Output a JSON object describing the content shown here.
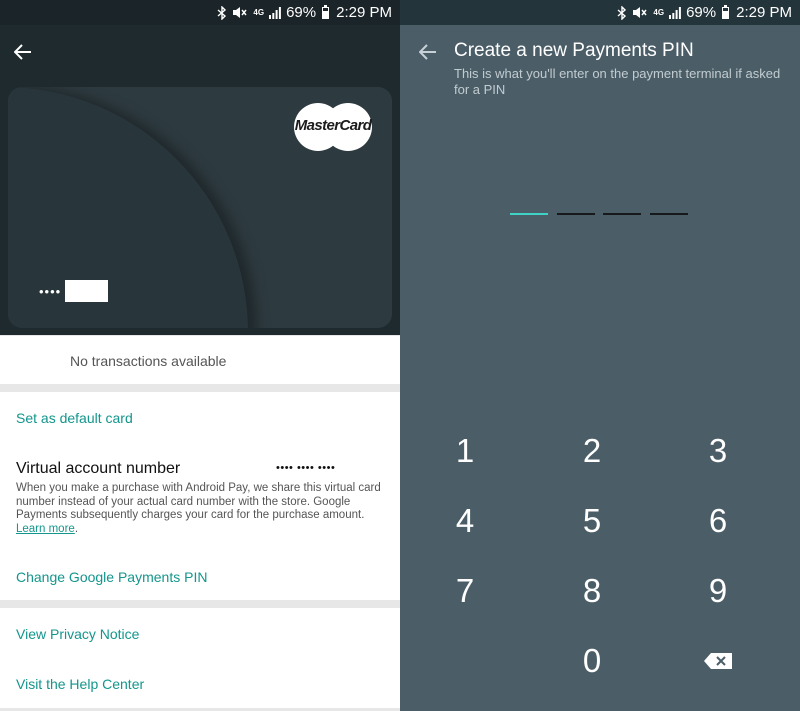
{
  "status_bar": {
    "network": "4G",
    "battery": "69%",
    "battery_fraction": 0.69,
    "time": "2:29 PM"
  },
  "left": {
    "card": {
      "brand": "MasterCard",
      "masked_number": "••••"
    },
    "transactions": {
      "empty_text": "No transactions available"
    },
    "options": {
      "set_default": "Set as default card",
      "van_title": "Virtual account number",
      "van_masked": "•••• •••• ••••",
      "van_desc": "When you make a purchase with Android Pay, we share this virtual card number instead of your actual card number with the store. Google Payments subsequently charges your card for the purchase amount.",
      "learn_more": "Learn more",
      "change_pin": "Change Google Payments PIN"
    },
    "help": {
      "privacy": "View Privacy Notice",
      "help_center": "Visit the Help Center"
    }
  },
  "right": {
    "title": "Create a new Payments PIN",
    "subtitle": "This is what you'll enter on the payment terminal if asked for a PIN",
    "pin_length": 4,
    "keypad": {
      "k1": "1",
      "k2": "2",
      "k3": "3",
      "k4": "4",
      "k5": "5",
      "k6": "6",
      "k7": "7",
      "k8": "8",
      "k9": "9",
      "k0": "0"
    }
  },
  "colors": {
    "accent": "#13968c",
    "pin_active": "#3fd2c6",
    "keypad_bg": "#4b5e68",
    "header_bg": "#1f2a2e"
  },
  "icons": {
    "back": "arrow-left-icon",
    "bluetooth": "bluetooth-icon",
    "mute": "vibrate-mute-icon",
    "signal": "signal-icon",
    "battery": "battery-icon",
    "backspace": "backspace-icon"
  }
}
